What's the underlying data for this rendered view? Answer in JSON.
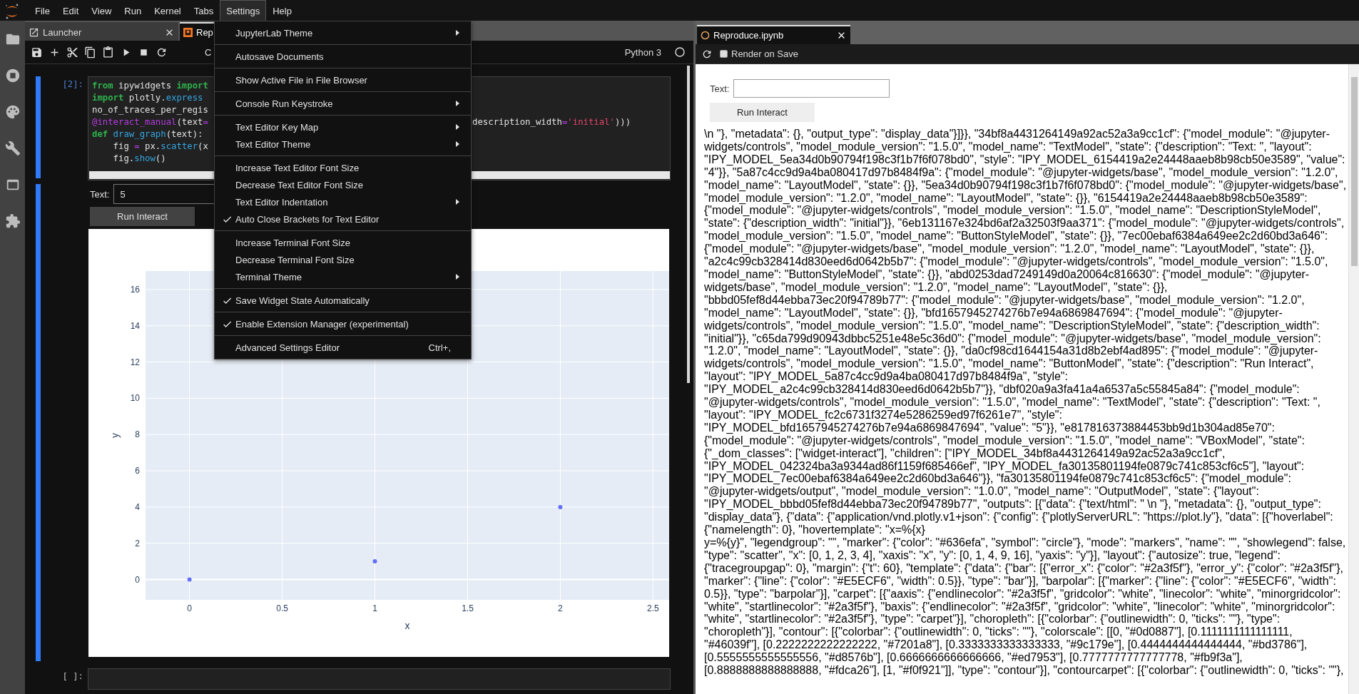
{
  "menu_bar": {
    "items": [
      {
        "label": "File",
        "selected": false
      },
      {
        "label": "Edit",
        "selected": false
      },
      {
        "label": "View",
        "selected": false
      },
      {
        "label": "Run",
        "selected": false
      },
      {
        "label": "Kernel",
        "selected": false
      },
      {
        "label": "Tabs",
        "selected": false
      },
      {
        "label": "Settings",
        "selected": true
      },
      {
        "label": "Help",
        "selected": false
      }
    ]
  },
  "notebook": {
    "tabs": [
      {
        "label": "Launcher",
        "selected": false
      },
      {
        "label": "Rep",
        "selected": true
      }
    ],
    "toolbar": {
      "cell_type": "C",
      "kernel": "Python 3"
    },
    "code_cell": {
      "prompt": "[2]:",
      "lines": [
        {
          "tokens": [
            {
              "kind": "kw",
              "text": "from"
            },
            {
              "kind": "plain",
              "text": " ipywidgets "
            },
            {
              "kind": "kw",
              "text": "import"
            }
          ]
        },
        {
          "tokens": [
            {
              "kind": "kw",
              "text": "import"
            },
            {
              "kind": "plain",
              "text": " plotly."
            },
            {
              "kind": "prop",
              "text": "express"
            }
          ]
        },
        {
          "tokens": [
            {
              "kind": "plain",
              "text": "no_of_traces_per_regis"
            }
          ]
        },
        {
          "tokens": [
            {
              "kind": "deco",
              "text": "@interact_manual"
            },
            {
              "kind": "plain",
              "text": "(text"
            },
            {
              "kind": "op",
              "text": "="
            }
          ],
          "tail": [
            {
              "kind": "plain",
              "text": "description_width"
            },
            {
              "kind": "op",
              "text": "="
            },
            {
              "kind": "str",
              "text": "'initial'"
            },
            {
              "kind": "plain",
              "text": ")))"
            }
          ]
        },
        {
          "tokens": [
            {
              "kind": "kw",
              "text": "def"
            },
            {
              "kind": "prop",
              "text": " draw_graph"
            },
            {
              "kind": "plain",
              "text": "(text):"
            }
          ]
        },
        {
          "tokens": [
            {
              "kind": "plain",
              "text": "    fig "
            },
            {
              "kind": "op",
              "text": "="
            },
            {
              "kind": "plain",
              "text": " px."
            },
            {
              "kind": "prop",
              "text": "scatter"
            },
            {
              "kind": "plain",
              "text": "(x"
            }
          ]
        },
        {
          "tokens": [
            {
              "kind": "plain",
              "text": "    fig."
            },
            {
              "kind": "prop",
              "text": "show"
            },
            {
              "kind": "plain",
              "text": "()"
            }
          ]
        }
      ]
    },
    "output": {
      "label": "Text:",
      "value": "5",
      "button": "Run Interact",
      "chart_data": {
        "type": "scatter",
        "grid": true,
        "xlabel": "x",
        "ylabel": "y",
        "x": [
          0,
          1,
          2
        ],
        "series": [
          {
            "color": "#636efa",
            "values": [
              0,
              1,
              4
            ]
          }
        ],
        "xlim": [
          -0.237,
          2.587
        ],
        "ylim": [
          -1.12,
          17.02
        ],
        "xticks": [
          0,
          0.5,
          1,
          1.5,
          2,
          2.5
        ],
        "yticks": [
          0,
          2,
          4,
          6,
          8,
          10,
          12,
          14,
          16
        ]
      }
    },
    "empty_cell": {
      "prompt": "[ ]:"
    }
  },
  "settings_menu": {
    "items": [
      {
        "kind": "item",
        "label": "JupyterLab Theme",
        "checked": false,
        "submenu": true
      },
      {
        "kind": "separator"
      },
      {
        "kind": "item",
        "label": "Autosave Documents",
        "checked": false,
        "submenu": false
      },
      {
        "kind": "separator"
      },
      {
        "kind": "item",
        "label": "Show Active File in File Browser",
        "checked": false,
        "submenu": false
      },
      {
        "kind": "separator"
      },
      {
        "kind": "item",
        "label": "Console Run Keystroke",
        "checked": false,
        "submenu": true
      },
      {
        "kind": "separator"
      },
      {
        "kind": "item",
        "label": "Text Editor Key Map",
        "checked": false,
        "submenu": true
      },
      {
        "kind": "item",
        "label": "Text Editor Theme",
        "checked": false,
        "submenu": true
      },
      {
        "kind": "separator"
      },
      {
        "kind": "item",
        "label": "Increase Text Editor Font Size",
        "checked": false,
        "submenu": false
      },
      {
        "kind": "item",
        "label": "Decrease Text Editor Font Size",
        "checked": false,
        "submenu": false
      },
      {
        "kind": "item",
        "label": "Text Editor Indentation",
        "checked": false,
        "submenu": true
      },
      {
        "kind": "item",
        "label": "Auto Close Brackets for Text Editor",
        "checked": true,
        "submenu": false
      },
      {
        "kind": "separator"
      },
      {
        "kind": "item",
        "label": "Increase Terminal Font Size",
        "checked": false,
        "submenu": false
      },
      {
        "kind": "item",
        "label": "Decrease Terminal Font Size",
        "checked": false,
        "submenu": false
      },
      {
        "kind": "item",
        "label": "Terminal Theme",
        "checked": false,
        "submenu": true
      },
      {
        "kind": "separator"
      },
      {
        "kind": "item",
        "label": "Save Widget State Automatically",
        "checked": true,
        "submenu": false
      },
      {
        "kind": "separator"
      },
      {
        "kind": "item",
        "label": "Enable Extension Manager (experimental)",
        "checked": true,
        "submenu": false
      },
      {
        "kind": "separator"
      },
      {
        "kind": "item",
        "label": "Advanced Settings Editor",
        "checked": false,
        "submenu": false,
        "shortcut": "Ctrl+,"
      }
    ]
  },
  "preview": {
    "tab": {
      "label": "Reproduce.ipynb",
      "selected": true
    },
    "toolbar": {
      "label": "Render on Save",
      "checked": false
    },
    "widget": {
      "label": "Text:",
      "button": "Run Interact"
    },
    "raw_text": "\\n \"}, \"metadata\": {}, \"output_type\": \"display_data\"}]}}, \"34bf8a4431264149a92ac52a3a9cc1cf\": {\"model_module\": \"@jupyter-widgets/controls\", \"model_module_version\": \"1.5.0\", \"model_name\": \"TextModel\", \"state\": {\"description\": \"Text: \", \"layout\": \"IPY_MODEL_5ea34d0b90794f198c3f1b7f6f078bd0\", \"style\": \"IPY_MODEL_6154419a2e24448aaeb8b98cb50e3589\", \"value\": \"4\"}}, \"5a87c4cc9d9a4ba080417d97b8484f9a\": {\"model_module\": \"@jupyter-widgets/base\", \"model_module_version\": \"1.2.0\", \"model_name\": \"LayoutModel\", \"state\": {}}, \"5ea34d0b90794f198c3f1b7f6f078bd0\": {\"model_module\": \"@jupyter-widgets/base\", \"model_module_version\": \"1.2.0\", \"model_name\": \"LayoutModel\", \"state\": {}}, \"6154419a2e24448aaeb8b98cb50e3589\": {\"model_module\": \"@jupyter-widgets/controls\", \"model_module_version\": \"1.5.0\", \"model_name\": \"DescriptionStyleModel\", \"state\": {\"description_width\": \"initial\"}}, \"6eb131167e324bd6af2a32503f9aa371\": {\"model_module\": \"@jupyter-widgets/controls\", \"model_module_version\": \"1.5.0\", \"model_name\": \"ButtonStyleModel\", \"state\": {}}, \"7ec00ebaf6384a649ee2c2d60bd3a646\": {\"model_module\": \"@jupyter-widgets/base\", \"model_module_version\": \"1.2.0\", \"model_name\": \"LayoutModel\", \"state\": {}}, \"a2c4c99cb328414d830eed6d0642b5b7\": {\"model_module\": \"@jupyter-widgets/controls\", \"model_module_version\": \"1.5.0\", \"model_name\": \"ButtonStyleModel\", \"state\": {}}, \"abd0253dad7249149d0a20064c816630\": {\"model_module\": \"@jupyter-widgets/base\", \"model_module_version\": \"1.2.0\", \"model_name\": \"LayoutModel\", \"state\": {}}, \"bbbd05fef8d44ebba73ec20f94789b77\": {\"model_module\": \"@jupyter-widgets/base\", \"model_module_version\": \"1.2.0\", \"model_name\": \"LayoutModel\", \"state\": {}}, \"bfd1657945274276b7e94a6869847694\": {\"model_module\": \"@jupyter-widgets/controls\", \"model_module_version\": \"1.5.0\", \"model_name\": \"DescriptionStyleModel\", \"state\": {\"description_width\": \"initial\"}}, \"c65da799d90943dbbc5251e48e5c36d0\": {\"model_module\": \"@jupyter-widgets/base\", \"model_module_version\": \"1.2.0\", \"model_name\": \"LayoutModel\", \"state\": {}}, \"da0cf98cd1644154a31d8b2ebf4ad895\": {\"model_module\": \"@jupyter-widgets/controls\", \"model_module_version\": \"1.5.0\", \"model_name\": \"ButtonModel\", \"state\": {\"description\": \"Run Interact\", \"layout\": \"IPY_MODEL_5a87c4cc9d9a4ba080417d97b8484f9a\", \"style\": \"IPY_MODEL_a2c4c99cb328414d830eed6d0642b5b7\"}}, \"dbf020a9a3fa41a4a6537a5c55845a84\": {\"model_module\": \"@jupyter-widgets/controls\", \"model_module_version\": \"1.5.0\", \"model_name\": \"TextModel\", \"state\": {\"description\": \"Text: \", \"layout\": \"IPY_MODEL_fc2c6731f3274e5286259ed97f6261e7\", \"style\": \"IPY_MODEL_bfd1657945274276b7e94a6869847694\", \"value\": \"5\"}}, \"e817816373884453bb9d1b304ad85e70\": {\"model_module\": \"@jupyter-widgets/controls\", \"model_module_version\": \"1.5.0\", \"model_name\": \"VBoxModel\", \"state\": {\"_dom_classes\": [\"widget-interact\"], \"children\": [\"IPY_MODEL_34bf8a4431264149a92ac52a3a9cc1cf\", \"IPY_MODEL_042324ba3a9344ad86f1159f685466ef\", \"IPY_MODEL_fa30135801194fe0879c741c853cf6c5\"], \"layout\": \"IPY_MODEL_7ec00ebaf6384a649ee2c2d60bd3a646\"}}, \"fa30135801194fe0879c741c853cf6c5\": {\"model_module\": \"@jupyter-widgets/output\", \"model_module_version\": \"1.0.0\", \"model_name\": \"OutputModel\", \"state\": {\"layout\": \"IPY_MODEL_bbbd05fef8d44ebba73ec20f94789b77\", \"outputs\": [{\"data\": {\"text/html\": \" \\n \"}, \"metadata\": {}, \"output_type\": \"display_data\"}, {\"data\": {\"application/vnd.plotly.v1+json\": {\"config\": {\"plotlyServerURL\": \"https://plot.ly\"}, \"data\": [{\"hoverlabel\": {\"namelength\": 0}, \"hovertemplate\": \"x=%{x}\ny=%{y}\", \"legendgroup\": \"\", \"marker\": {\"color\": \"#636efa\", \"symbol\": \"circle\"}, \"mode\": \"markers\", \"name\": \"\", \"showlegend\": false, \"type\": \"scatter\", \"x\": [0, 1, 2, 3, 4], \"xaxis\": \"x\", \"y\": [0, 1, 4, 9, 16], \"yaxis\": \"y\"}], \"layout\": {\"autosize\": true, \"legend\": {\"tracegroupgap\": 0}, \"margin\": {\"t\": 60}, \"template\": {\"data\": {\"bar\": [{\"error_x\": {\"color\": \"#2a3f5f\"}, \"error_y\": {\"color\": \"#2a3f5f\"}, \"marker\": {\"line\": {\"color\": \"#E5ECF6\", \"width\": 0.5}}, \"type\": \"bar\"}], \"barpolar\": [{\"marker\": {\"line\": {\"color\": \"#E5ECF6\", \"width\": 0.5}}, \"type\": \"barpolar\"}], \"carpet\": [{\"aaxis\": {\"endlinecolor\": \"#2a3f5f\", \"gridcolor\": \"white\", \"linecolor\": \"white\", \"minorgridcolor\": \"white\", \"startlinecolor\": \"#2a3f5f\"}, \"baxis\": {\"endlinecolor\": \"#2a3f5f\", \"gridcolor\": \"white\", \"linecolor\": \"white\", \"minorgridcolor\": \"white\", \"startlinecolor\": \"#2a3f5f\"}, \"type\": \"carpet\"}], \"choropleth\": [{\"colorbar\": {\"outlinewidth\": 0, \"ticks\": \"\"}, \"type\": \"choropleth\"}], \"contour\": [{\"colorbar\": {\"outlinewidth\": 0, \"ticks\": \"\"}, \"colorscale\": [[0, \"#0d0887\"], [0.1111111111111111, \"#46039f\"], [0.2222222222222222, \"#7201a8\"], [0.3333333333333333, \"#9c179e\"], [0.4444444444444444, \"#bd3786\"], [0.5555555555555556, \"#d8576b\"], [0.6666666666666666, \"#ed7953\"], [0.7777777777777778, \"#fb9f3a\"], [0.8888888888888888, \"#fdca26\"], [1, \"#f0f921\"]], \"type\": \"contour\"}], \"contourcarpet\": [{\"colorbar\": {\"outlinewidth\": 0, \"ticks\": \"\"},"
  }
}
